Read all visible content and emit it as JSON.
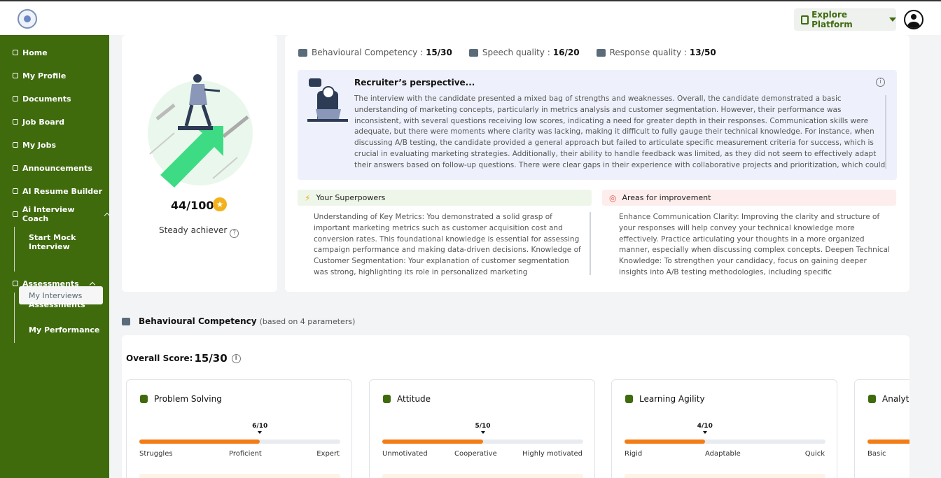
{
  "header": {
    "explore_label": "Explore Platform",
    "logo_icon": "emblem-logo",
    "profile_icon": "user-circle-icon"
  },
  "sidebar": {
    "items": [
      {
        "label": "Home",
        "icon": "home-icon"
      },
      {
        "label": "My Profile",
        "icon": "user-icon"
      },
      {
        "label": "Documents",
        "icon": "folder-icon"
      },
      {
        "label": "Job Board",
        "icon": "board-icon"
      },
      {
        "label": "My Jobs",
        "icon": "briefcase-icon"
      },
      {
        "label": "Announcements",
        "icon": "megaphone-icon"
      },
      {
        "label": "AI Resume Builder",
        "icon": "document-icon"
      },
      {
        "label": "Ai Interview Coach",
        "icon": "coach-icon"
      },
      {
        "label": "Assessments",
        "icon": "gear-icon"
      }
    ],
    "interview_sub": [
      "Start Mock Interview",
      "My Interviews"
    ],
    "assessment_sub": [
      "Assessments",
      "My Performance"
    ]
  },
  "score": {
    "value": "44/100",
    "label": "Steady achiever"
  },
  "metrics": [
    {
      "label": "Behavioural Competency :",
      "value": "15/30",
      "icon": "people-gear-icon"
    },
    {
      "label": "Speech quality :",
      "value": "16/20",
      "icon": "soundwave-icon"
    },
    {
      "label": "Response quality :",
      "value": "13/50",
      "icon": "chat-bubbles-icon"
    }
  ],
  "recruiter": {
    "title": "Recruiter’s perspective...",
    "text": "The interview with the candidate presented a mixed bag of strengths and weaknesses. Overall, the candidate demonstrated a basic understanding of marketing concepts, particularly in metrics analysis and customer segmentation. However, their performance was inconsistent, with several questions receiving low scores, indicating a need for greater depth in their responses. Communication skills were adequate, but there were moments where clarity was lacking, making it difficult to fully gauge their technical knowledge. For instance, when discussing A/B testing, the candidate provided a general approach but failed to articulate specific measurement criteria for success, which is crucial in evaluating marketing strategies. Additionally, their ability to handle feedback was limited, as they did not seem to effectively adapt their answers based on follow-up questions. There were clear gaps in their experience with collaborative projects and prioritization, which could"
  },
  "superpowers": {
    "title": "Your Superpowers",
    "text": "Understanding of Key Metrics: You demonstrated a solid grasp of important marketing metrics such as customer acquisition cost and conversion rates. This foundational knowledge is essential for assessing campaign performance and making data-driven decisions. Knowledge of Customer Segmentation: Your explanation of customer segmentation was strong, highlighting its role in personalized marketing"
  },
  "improvement": {
    "title": "Areas for improvement",
    "text": "Enhance Communication Clarity: Improving the clarity and structure of your responses will help convey your technical knowledge more effectively. Practice articulating your thoughts in a more organized manner, especially when discussing complex concepts. Deepen Technical Knowledge: To strengthen your candidacy, focus on gaining deeper insights into A/B testing methodologies, including specific"
  },
  "behavioural": {
    "title": "Behavioural Competency",
    "subtitle": "(based on 4 parameters)",
    "overall_label": "Overall Score:",
    "overall_value": "15/30",
    "cards": [
      {
        "name": "Problem Solving",
        "value_label": "6/10",
        "value": 6,
        "max": 10,
        "labels": [
          "Struggles",
          "Proficient",
          "Expert"
        ]
      },
      {
        "name": "Attitude",
        "value_label": "5/10",
        "value": 5,
        "max": 10,
        "labels": [
          "Unmotivated",
          "Cooperative",
          "Highly motivated"
        ]
      },
      {
        "name": "Learning Agility",
        "value_label": "4/10",
        "value": 4,
        "max": 10,
        "labels": [
          "Rigid",
          "Adaptable",
          "Quick"
        ]
      },
      {
        "name": "Analytical Thinking",
        "labels": [
          "Basic"
        ]
      }
    ]
  },
  "colors": {
    "sidebar": "#3f6b0d",
    "accent_orange": "#f47c16",
    "star": "#f2b21b"
  }
}
